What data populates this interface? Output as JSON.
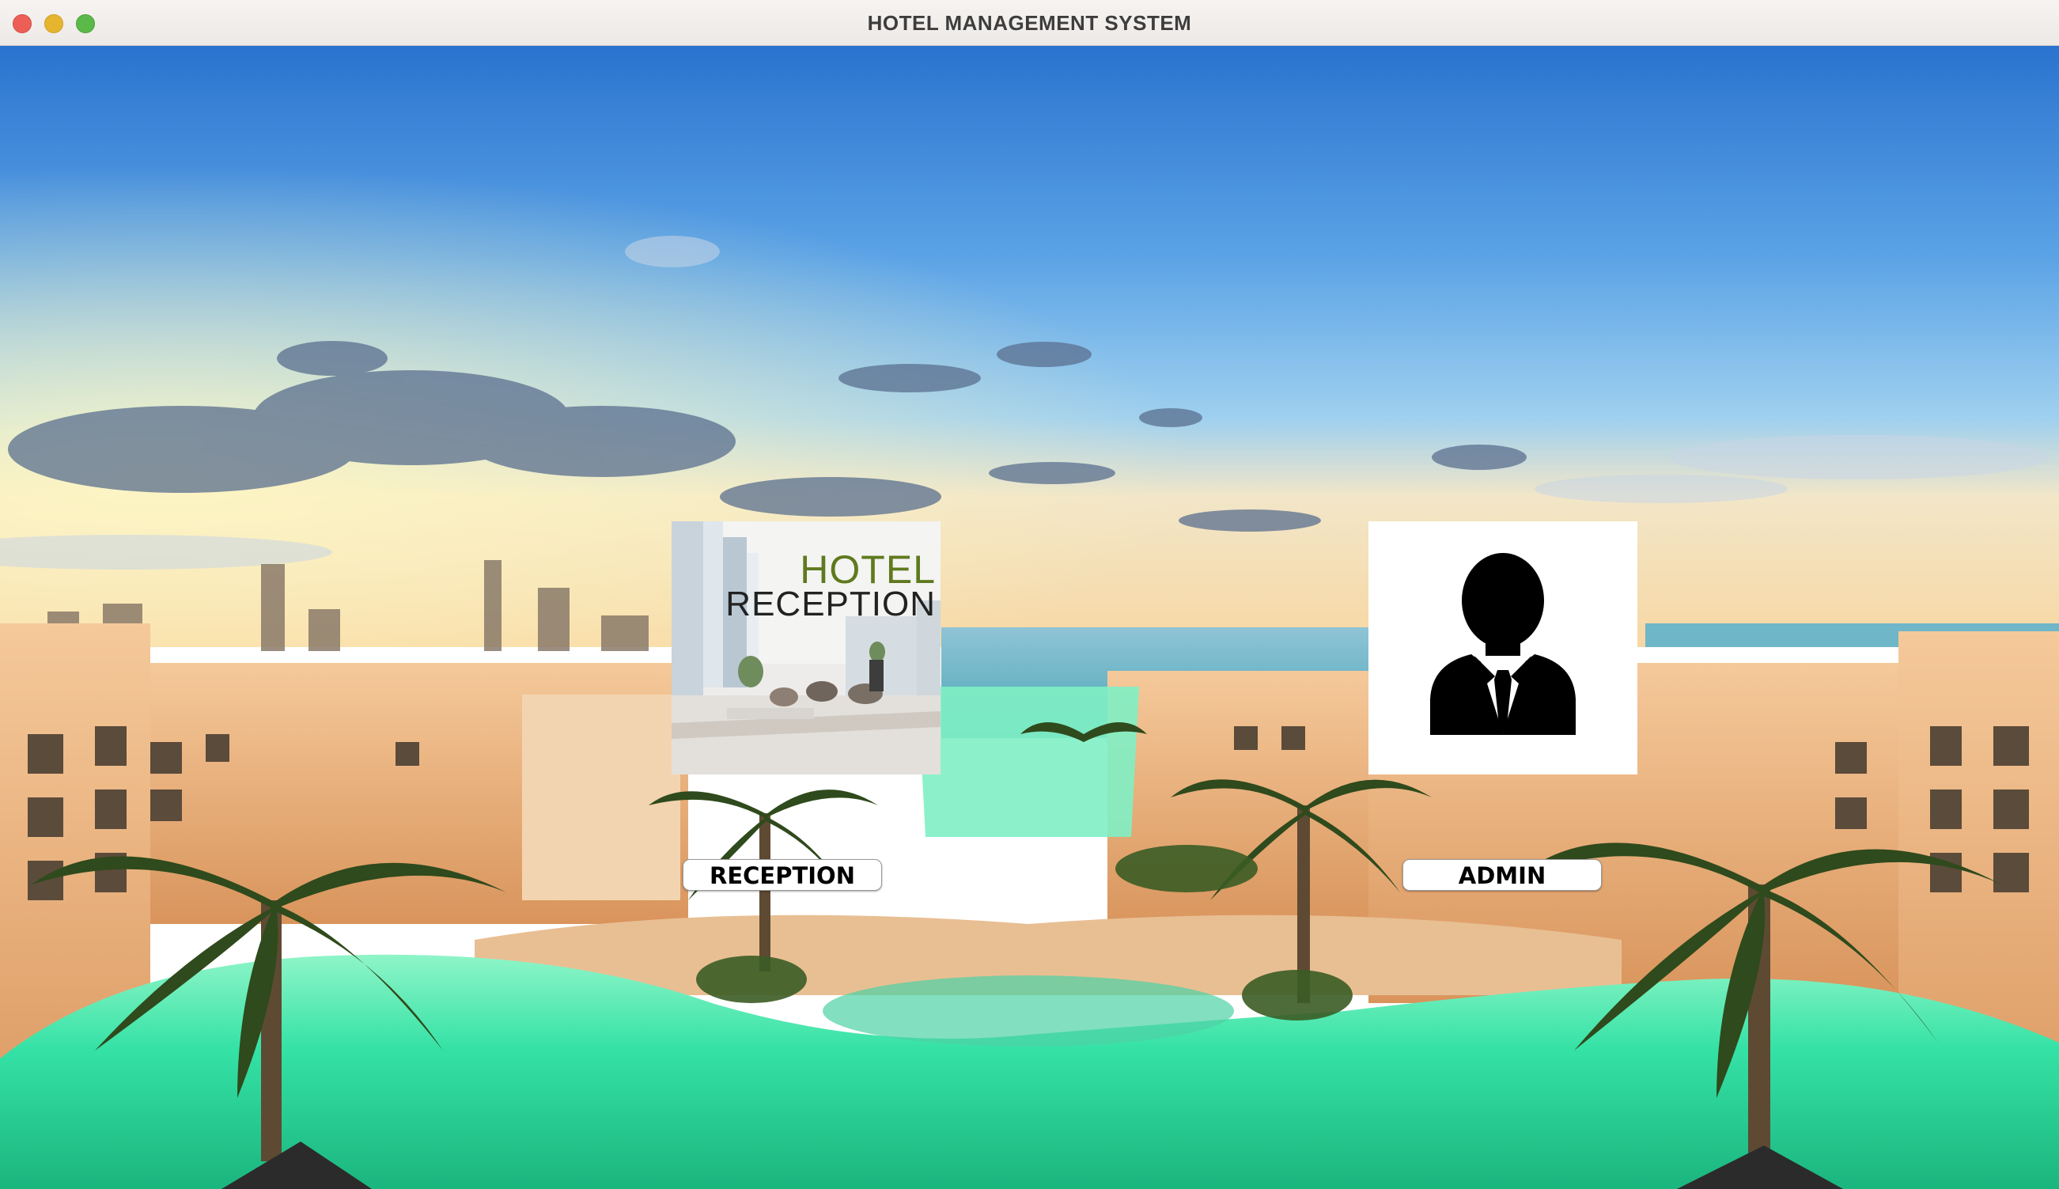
{
  "window": {
    "title": "HOTEL MANAGEMENT SYSTEM"
  },
  "reception_tile": {
    "heading": "HOTEL",
    "subheading": "RECEPTION",
    "icon": "hotel-reception-image"
  },
  "admin_tile": {
    "icon": "businessman-avatar-icon"
  },
  "buttons": {
    "reception_label": "RECEPTION",
    "admin_label": "ADMIN"
  },
  "colors": {
    "title_text": "#3d3d3d",
    "close": "#ec5f57",
    "minimize": "#e6b530",
    "maximize": "#5bb94a",
    "hotel_word": "#5f7a1e",
    "pool": "#2fe0a5",
    "sky": "#3f86d6"
  }
}
